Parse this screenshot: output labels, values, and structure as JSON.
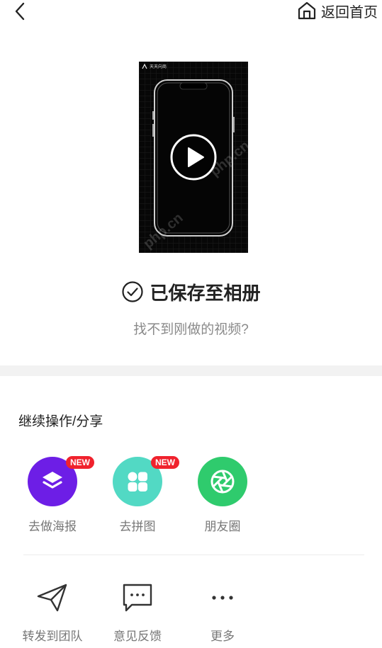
{
  "nav": {
    "back_icon": "chevron-left-icon",
    "home_icon": "home-icon",
    "home_label": "返回首页"
  },
  "preview": {
    "brand_icon": "app-logo-icon",
    "brand_label": "天天向商",
    "play_icon": "play-icon",
    "watermark": "php.cn"
  },
  "saved": {
    "icon": "check-circle-icon",
    "text": "已保存至相册",
    "help_link": "找不到刚做的视频?"
  },
  "section": {
    "title": "继续操作/分享"
  },
  "actions": [
    {
      "label": "去做海报",
      "icon": "layers-icon",
      "badge": "NEW",
      "color": "#6d1ee6"
    },
    {
      "label": "去拼图",
      "icon": "grid-icon",
      "badge": "NEW",
      "color": "#52d9c4"
    },
    {
      "label": "朋友圈",
      "icon": "aperture-icon",
      "badge": "",
      "color": "#2fcb6d"
    }
  ],
  "bottom": [
    {
      "label": "转发到团队",
      "icon": "send-icon"
    },
    {
      "label": "意见反馈",
      "icon": "feedback-icon"
    },
    {
      "label": "更多",
      "icon": "more-icon"
    }
  ]
}
